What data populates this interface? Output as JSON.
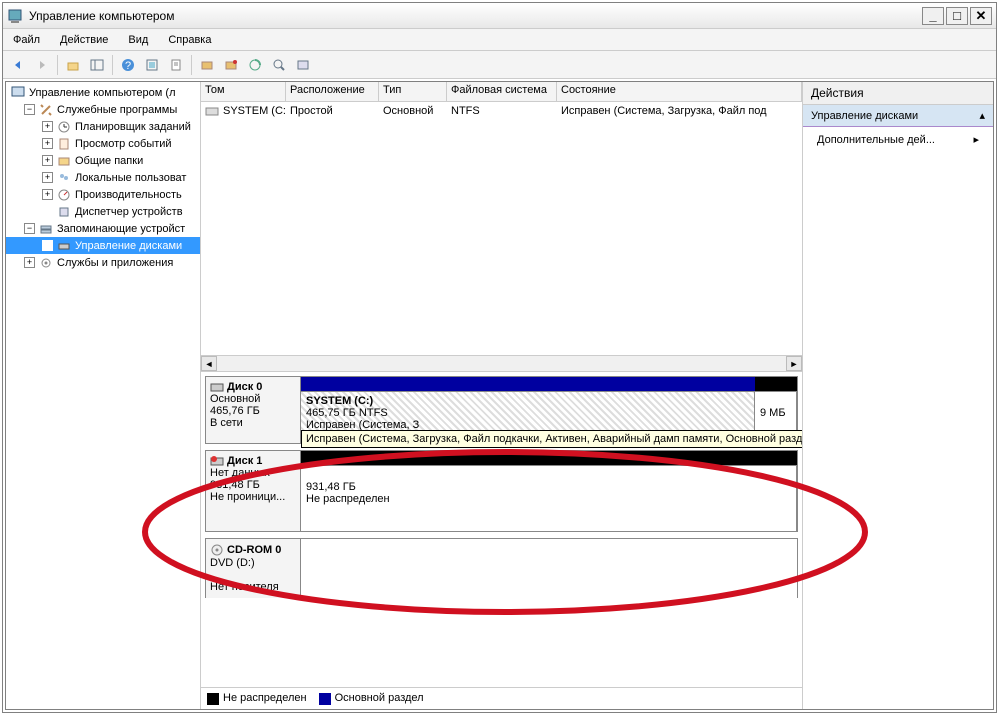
{
  "title": "Управление компьютером",
  "menu": {
    "file": "Файл",
    "action": "Действие",
    "view": "Вид",
    "help": "Справка"
  },
  "tree": {
    "root": "Управление компьютером (л",
    "systools": "Служебные программы",
    "sched": "Планировщик заданий",
    "evt": "Просмотр событий",
    "shared": "Общие папки",
    "users": "Локальные пользоват",
    "perf": "Производительность",
    "devmgr": "Диспетчер устройств",
    "storage": "Запоминающие устройст",
    "diskmgmt": "Управление дисками",
    "services": "Службы и приложения"
  },
  "cols": {
    "vol": "Том",
    "layout": "Расположение",
    "type": "Тип",
    "fs": "Файловая система",
    "status": "Состояние"
  },
  "row1": {
    "vol": "SYSTEM (C:)",
    "layout": "Простой",
    "type": "Основной",
    "fs": "NTFS",
    "status": "Исправен (Система, Загрузка, Файл под"
  },
  "disk0": {
    "name": "Диск 0",
    "kind": "Основной",
    "size": "465,76 ГБ",
    "state": "В сети",
    "p1name": "SYSTEM  (C:)",
    "p1size": "465,75 ГБ NTFS",
    "p1status": "Исправен (Система, З",
    "p2size": "9 МБ",
    "tooltip": "Исправен (Система, Загрузка, Файл подкачки, Активен, Аварийный дамп памяти, Основной раздел)"
  },
  "disk1": {
    "name": "Диск 1",
    "kind": "Нет данных",
    "size": "931,48 ГБ",
    "state": "Не проиници...",
    "p1size": "931,48 ГБ",
    "p1status": "Не распределен"
  },
  "cdrom": {
    "name": "CD-ROM 0",
    "kind": "DVD (D:)",
    "state": "Нет носителя"
  },
  "legend": {
    "unalloc": "Не распределен",
    "primary": "Основной раздел"
  },
  "actions": {
    "header": "Действия",
    "section": "Управление дисками",
    "more": "Дополнительные дей..."
  }
}
